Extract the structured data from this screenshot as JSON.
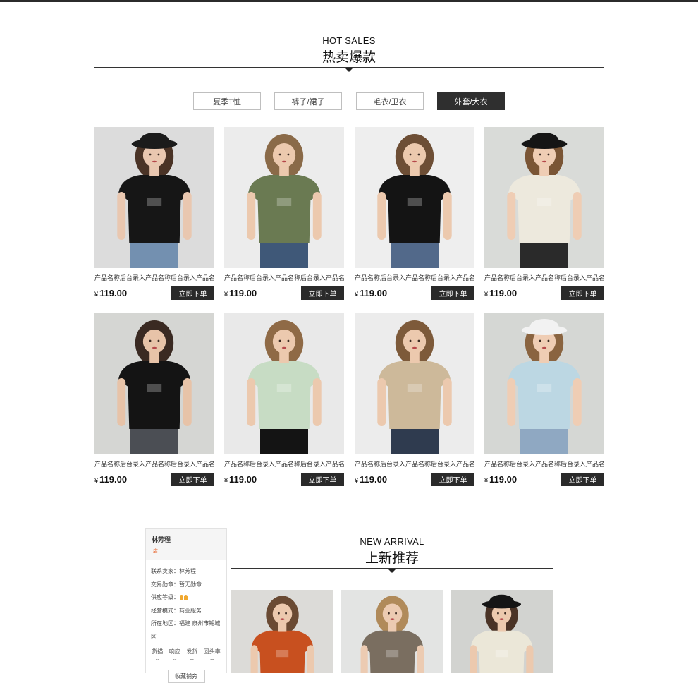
{
  "hot": {
    "title_en": "HOT SALES",
    "title_zh": "热卖爆款",
    "tabs": [
      "夏季T恤",
      "裤子/裙子",
      "毛衣/卫衣",
      "外套/大衣"
    ],
    "active_tab_index": 3,
    "products": [
      {
        "name": "产品名称后台录入产品名称后台录入产品名",
        "currency": "¥",
        "price": "119.00",
        "button": "立即下单",
        "bg": "#dcdcdc",
        "shirt": "#161616",
        "pants": "#7390b0",
        "hair": "#4a3326",
        "hat": true,
        "hatColor": "#1b1b1b",
        "skin": "#e9c7b0"
      },
      {
        "name": "产品名称后台录入产品名称后台录入产品名",
        "currency": "¥",
        "price": "119.00",
        "button": "立即下单",
        "bg": "#ececec",
        "shirt": "#6a7a52",
        "pants": "#3f5878",
        "hair": "#8a6a48",
        "hat": false,
        "skin": "#ecc9ae"
      },
      {
        "name": "产品名称后台录入产品名称后台录入产品名",
        "currency": "¥",
        "price": "119.00",
        "button": "立即下单",
        "bg": "#eeeeee",
        "shirt": "#141414",
        "pants": "#52698a",
        "hair": "#6d4e35",
        "hat": false,
        "skin": "#ecc9ae"
      },
      {
        "name": "产品名称后台录入产品名称后台录入产品名",
        "currency": "¥",
        "price": "119.00",
        "button": "立即下单",
        "bg": "#d9dbd8",
        "shirt": "#ede9dd",
        "pants": "#2a2a2a",
        "hair": "#7a5535",
        "hat": true,
        "hatColor": "#151515",
        "skin": "#efcdb4"
      },
      {
        "name": "产品名称后台录入产品名称后台录入产品名",
        "currency": "¥",
        "price": "119.00",
        "button": "立即下单",
        "bg": "#d5d6d3",
        "shirt": "#141414",
        "pants": "#4b4e54",
        "hair": "#3a2a22",
        "hat": false,
        "skin": "#e7c3a8"
      },
      {
        "name": "产品名称后台录入产品名称后台录入产品名",
        "currency": "¥",
        "price": "119.00",
        "button": "立即下单",
        "bg": "#e9e9e9",
        "shirt": "#c7dcc4",
        "pants": "#141414",
        "hair": "#8f6a46",
        "hat": false,
        "skin": "#ecc9ae"
      },
      {
        "name": "产品名称后台录入产品名称后台录入产品名",
        "currency": "¥",
        "price": "119.00",
        "button": "立即下单",
        "bg": "#ececec",
        "shirt": "#cdb99a",
        "pants": "#2f3b4f",
        "hair": "#7d5a3a",
        "hat": false,
        "skin": "#ecc9ae"
      },
      {
        "name": "产品名称后台录入产品名称后台录入产品名",
        "currency": "¥",
        "price": "119.00",
        "button": "立即下单",
        "bg": "#d5d7d4",
        "shirt": "#bcd7e3",
        "pants": "#8fa8c2",
        "hair": "#8a6440",
        "hat": true,
        "hatColor": "#f2f2f2",
        "skin": "#efcdb4"
      }
    ]
  },
  "shop": {
    "name": "林芳程",
    "badge": "店",
    "contact_label": "联系卖家：",
    "contact_value": "林芳程",
    "medal_label": "交易勋章：",
    "medal_value": "暂无勋章",
    "level_label": "供应等级：",
    "mode_label": "经营模式：",
    "mode_value": "商业服务",
    "area_label": "所在地区：",
    "area_value": "福建 泉州市鲤城区",
    "stats": [
      {
        "label": "货描",
        "value": "--"
      },
      {
        "label": "响应",
        "value": "--"
      },
      {
        "label": "发货",
        "value": "--"
      },
      {
        "label": "回头率",
        "value": "--"
      }
    ],
    "fav_button": "收藏铺旁"
  },
  "arrival": {
    "title_en": "NEW ARRIVAL",
    "title_zh": "上新推荐",
    "products": [
      {
        "bg": "#dcdbd8",
        "shirt": "#c8501f",
        "hair": "#6a4a33",
        "hat": false,
        "skin": "#ecc9ae"
      },
      {
        "bg": "#e3e4e3",
        "shirt": "#7a6e60",
        "hair": "#b08a5a",
        "hat": false,
        "skin": "#eccbb2"
      },
      {
        "bg": "#d2d3d0",
        "shirt": "#ebe7d8",
        "hair": "#4a3326",
        "hat": true,
        "hatColor": "#151515",
        "skin": "#ecc9ae"
      }
    ]
  }
}
